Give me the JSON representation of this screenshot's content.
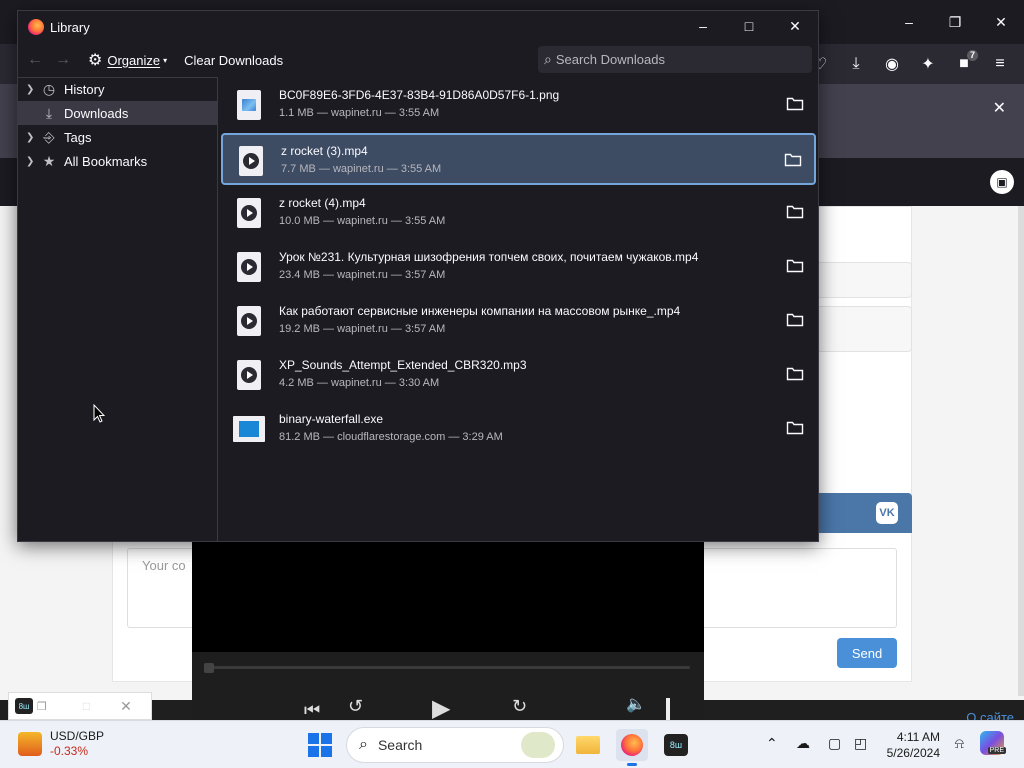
{
  "library": {
    "title": "Library",
    "toolbar": {
      "back_icon": "back-arrow-icon",
      "forward_icon": "forward-arrow-icon",
      "organize_label": "Organize",
      "clear_label": "Clear Downloads",
      "search_placeholder": "Search Downloads"
    },
    "sidebar": {
      "items": [
        {
          "label": "History",
          "icon": "clock-icon",
          "expandable": true,
          "selected": false
        },
        {
          "label": "Downloads",
          "icon": "download-icon",
          "expandable": false,
          "selected": true
        },
        {
          "label": "Tags",
          "icon": "tag-icon",
          "expandable": true,
          "selected": false
        },
        {
          "label": "All Bookmarks",
          "icon": "star-icon",
          "expandable": true,
          "selected": false
        }
      ]
    },
    "downloads": [
      {
        "name": "BC0F89E6-3FD6-4E37-83B4-91D86A0D57F6-1.png",
        "meta": "1.1 MB — wapinet.ru — 3:55 AM",
        "type": "image",
        "selected": false
      },
      {
        "name": "z rocket (3).mp4",
        "meta": "7.7 MB — wapinet.ru — 3:55 AM",
        "type": "video",
        "selected": true
      },
      {
        "name": "z rocket (4).mp4",
        "meta": "10.0 MB — wapinet.ru — 3:55 AM",
        "type": "video",
        "selected": false
      },
      {
        "name": "Урок №231. Культурная шизофрения топчем своих, почитаем чужаков.mp4",
        "meta": "23.4 MB — wapinet.ru — 3:57 AM",
        "type": "video",
        "selected": false
      },
      {
        "name": "Как работают сервисные инженеры компании на массовом рынке_.mp4",
        "meta": "19.2 MB — wapinet.ru — 3:57 AM",
        "type": "video",
        "selected": false
      },
      {
        "name": "XP_Sounds_Attempt_Extended_CBR320.mp3",
        "meta": "4.2 MB — wapinet.ru — 3:30 AM",
        "type": "video",
        "selected": false
      },
      {
        "name": "binary-waterfall.exe",
        "meta": "81.2 MB — cloudflarestorage.com — 3:29 AM",
        "type": "exe",
        "selected": false
      }
    ]
  },
  "background": {
    "extension_badge": "7",
    "comment_placeholder": "Your co",
    "send_label": "Send",
    "vk_label": "VK",
    "bottom_link": "О сайте"
  },
  "pip": {
    "app_label": "8ш"
  },
  "taskbar": {
    "widget_title": "USD/GBP",
    "widget_change": "-0.33%",
    "search_label": "Search",
    "player_label": "8ш",
    "clock_time": "4:11 AM",
    "clock_date": "5/26/2024",
    "copilot_badge": "PRE"
  }
}
